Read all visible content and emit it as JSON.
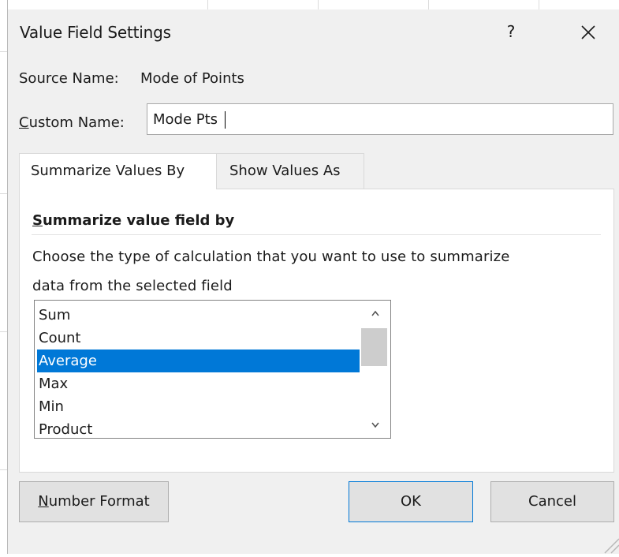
{
  "dialog": {
    "title": "Value Field Settings",
    "help_label": "?",
    "close_icon": "close-icon"
  },
  "source": {
    "label": "Source Name:",
    "value": "Mode of Points"
  },
  "custom": {
    "label_mnemonic": "C",
    "label_rest": "ustom Name:",
    "value": "Mode Pts"
  },
  "tabs": [
    {
      "label": "Summarize Values By",
      "selected": true
    },
    {
      "label": "Show Values As",
      "selected": false
    }
  ],
  "summarize": {
    "heading_mnemonic": "S",
    "heading_rest": "ummarize value field by",
    "description_line1": "Choose the type of calculation that you want to use to summarize",
    "description_line2": "data from the selected field",
    "items": [
      "Sum",
      "Count",
      "Average",
      "Max",
      "Min",
      "Product"
    ],
    "selected": "Average"
  },
  "buttons": {
    "number_format_mnemonic": "N",
    "number_format_rest": "umber Format",
    "ok": "OK",
    "cancel": "Cancel"
  },
  "colors": {
    "dialog_bg": "#f0f0f0",
    "selection": "#0078d7",
    "button_bg": "#e1e1e1"
  }
}
